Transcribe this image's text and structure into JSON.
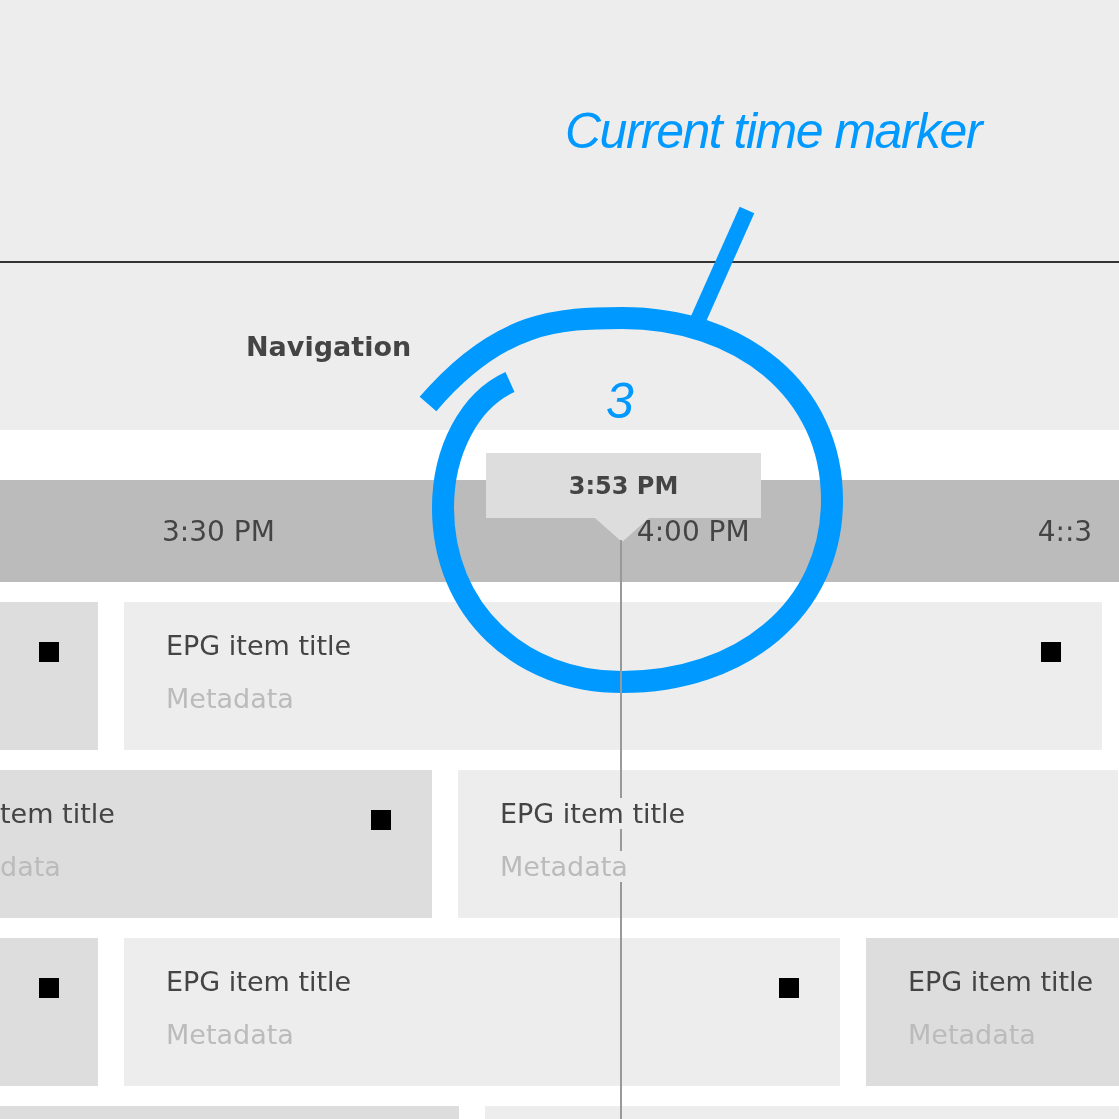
{
  "header": {
    "label": "Navigation"
  },
  "timeline": {
    "times": [
      "3:30 PM",
      "4:00 PM",
      "4::3"
    ]
  },
  "current_time": {
    "label": "3:53 PM"
  },
  "rows": [
    {
      "cells": [
        {
          "kind": "shaded",
          "icon": true
        },
        {
          "kind": "plain",
          "title": "EPG item title",
          "metadata": "Metadata",
          "icon": true
        }
      ]
    },
    {
      "cells": [
        {
          "kind": "shaded",
          "title": "tem title",
          "metadata": "data",
          "icon": true
        },
        {
          "kind": "plain",
          "title": "EPG item title",
          "metadata": "Metadata",
          "icon": false
        }
      ]
    },
    {
      "cells": [
        {
          "kind": "shaded",
          "icon": true
        },
        {
          "kind": "plain",
          "title": "EPG item title",
          "metadata": "Metadata",
          "icon": true
        },
        {
          "kind": "shaded",
          "title": "EPG item title",
          "metadata": "Metadata",
          "icon": false
        }
      ]
    },
    {
      "cells": [
        {
          "kind": "shaded"
        },
        {
          "kind": "plain"
        }
      ]
    }
  ],
  "annotation": {
    "title": "Current time marker",
    "number": "3"
  }
}
